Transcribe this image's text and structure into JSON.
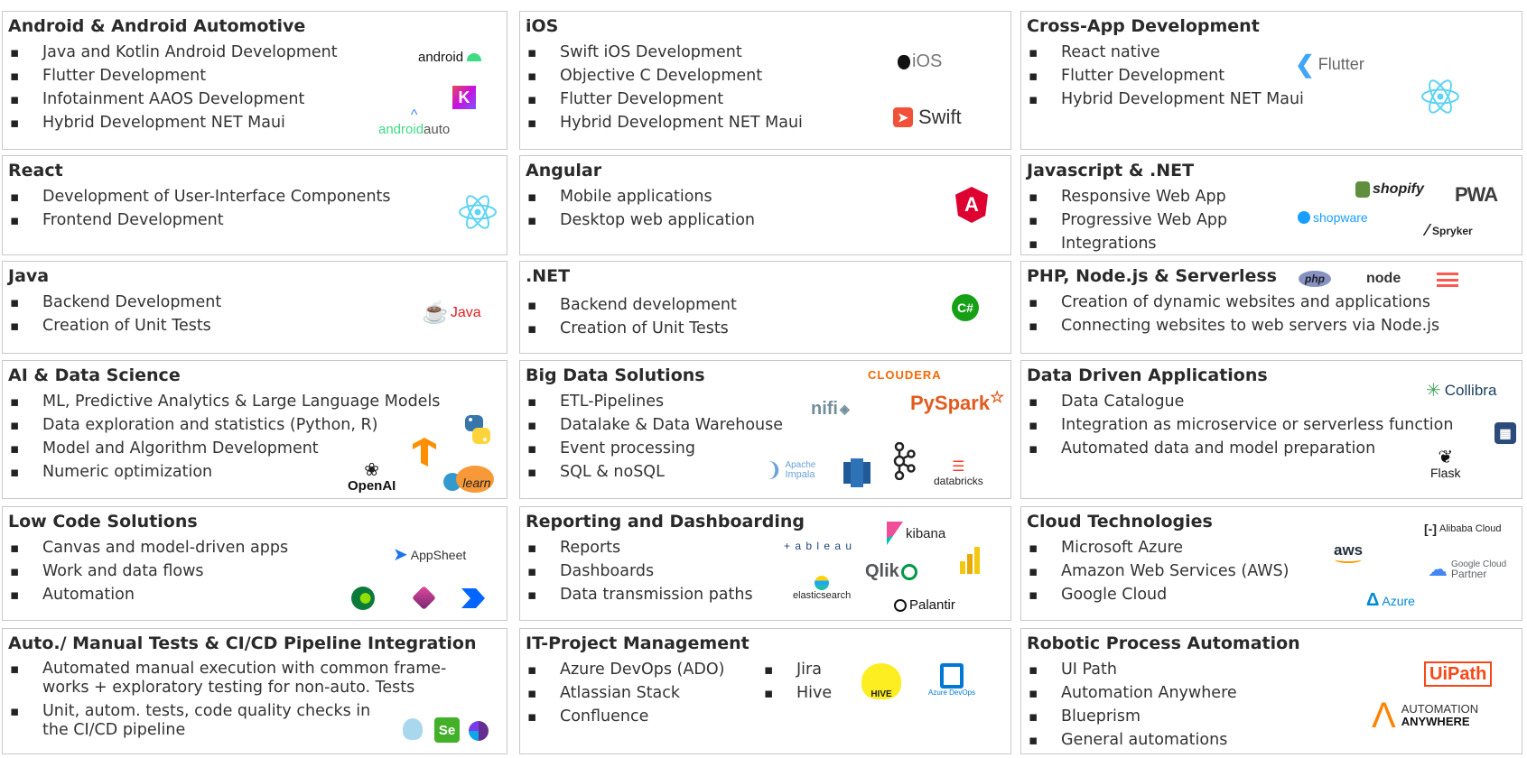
{
  "cards": {
    "android": {
      "title": "Android & Android Automotive",
      "items": [
        "Java and Kotlin Android Development",
        "Flutter Development",
        "Infotainment AAOS Development",
        "Hybrid Development NET Maui"
      ],
      "logos": {
        "android": "android",
        "kotlin": "K",
        "androidauto_a": "android",
        "androidauto_b": "auto"
      }
    },
    "ios": {
      "title": "iOS",
      "items": [
        "Swift iOS Development",
        "Objective C Development",
        "Flutter Development",
        "Hybrid Development NET Maui"
      ],
      "logos": {
        "ios": "iOS",
        "swift": "Swift"
      }
    },
    "crossapp": {
      "title": "Cross-App Development",
      "items": [
        "React native",
        "Flutter Development",
        "Hybrid Development NET Maui"
      ],
      "logos": {
        "flutter": "Flutter"
      }
    },
    "react": {
      "title": "React",
      "items": [
        "Development of User-Interface Components",
        "Frontend Development"
      ]
    },
    "angular": {
      "title": "Angular",
      "items": [
        "Mobile applications",
        "Desktop web application"
      ],
      "logos": {
        "angular": "A"
      }
    },
    "jsnet": {
      "title": "Javascript & .NET",
      "items": [
        "Responsive Web App",
        "Progressive Web App",
        "Integrations"
      ],
      "logos": {
        "shopify": "shopify",
        "pwa": "PWA",
        "shopware": "shopware",
        "spryker": "Spryker"
      }
    },
    "java": {
      "title": "Java",
      "items": [
        "Backend Development",
        "Creation of Unit Tests"
      ],
      "logos": {
        "java": "Java"
      }
    },
    "dotnet": {
      "title": ".NET",
      "items": [
        "Backend development",
        "Creation of Unit Tests"
      ],
      "logos": {
        "csharp": "C#"
      }
    },
    "php": {
      "title": "PHP, Node.js & Serverless",
      "items": [
        "Creation of dynamic websites and applications",
        "Connecting websites to web servers via Node.js"
      ],
      "logos": {
        "php": "php",
        "node": "node"
      }
    },
    "ai": {
      "title": "AI & Data Science",
      "items": [
        "ML, Predictive Analytics & Large Language Models",
        "Data exploration and statistics (Python, R)",
        "Model and Algorithm Development",
        "Numeric optimization"
      ],
      "logos": {
        "openai": "OpenAI",
        "sklearn": "learn"
      }
    },
    "bigdata": {
      "title": "Big Data Solutions",
      "items": [
        "ETL-Pipelines",
        "Datalake & Data Warehouse",
        "Event processing",
        "SQL & noSQL"
      ],
      "logos": {
        "cloudera": "CLOUDERA",
        "nifi": "nifi",
        "pyspark": "PySpark",
        "impala_a": "Apache",
        "impala_b": "Impala",
        "databricks": "databricks"
      }
    },
    "datadriven": {
      "title": "Data Driven Applications",
      "items": [
        "Data Catalogue",
        "Integration as microservice or serverless function",
        "Automated data and model preparation"
      ],
      "logos": {
        "collibra": "Collibra",
        "flask": "Flask"
      }
    },
    "lowcode": {
      "title": "Low Code Solutions",
      "items": [
        "Canvas and model-driven apps",
        "Work and data flows",
        "Automation"
      ],
      "logos": {
        "appsheet": "AppSheet"
      }
    },
    "reporting": {
      "title": "Reporting and Dashboarding",
      "items": [
        "Reports",
        "Dashboards",
        "Data transmission paths"
      ],
      "logos": {
        "kibana": "kibana",
        "tableau": "+ a b l e a u",
        "qlik": "Qlik",
        "elastic": "elasticsearch",
        "palantir": "Palantir"
      }
    },
    "cloud": {
      "title": "Cloud Technologies",
      "items": [
        "Microsoft Azure",
        "Amazon Web Services (AWS)",
        "Google Cloud"
      ],
      "logos": {
        "alibaba": "Alibaba Cloud",
        "aws": "aws",
        "google_a": "Google Cloud",
        "google_b": "Partner",
        "azure": "Azure"
      }
    },
    "tests": {
      "title": "Auto./ Manual Tests & CI/CD Pipeline Integration",
      "items": [
        "Automated manual execution with common frame-works + exploratory testing for non-auto. Tests",
        "Unit, autom. tests, code quality checks in the CI/CD pipeline"
      ],
      "logos": {
        "selenium": "Se"
      }
    },
    "itpm": {
      "title": "IT-Project Management",
      "items": [
        "Azure DevOps (ADO)",
        "Atlassian Stack",
        "Confluence"
      ],
      "items2": [
        "Jira",
        "Hive"
      ],
      "logos": {
        "hive": "HIVE",
        "azuredevops": "Azure DevOps"
      }
    },
    "rpa": {
      "title": "Robotic Process Automation",
      "items": [
        "UI Path",
        "Automation Anywhere",
        "Blueprism",
        "General automations"
      ],
      "logos": {
        "uipath": "UiPath",
        "aa_a": "AUTOMATION",
        "aa_b": "ANYWHERE"
      }
    }
  }
}
